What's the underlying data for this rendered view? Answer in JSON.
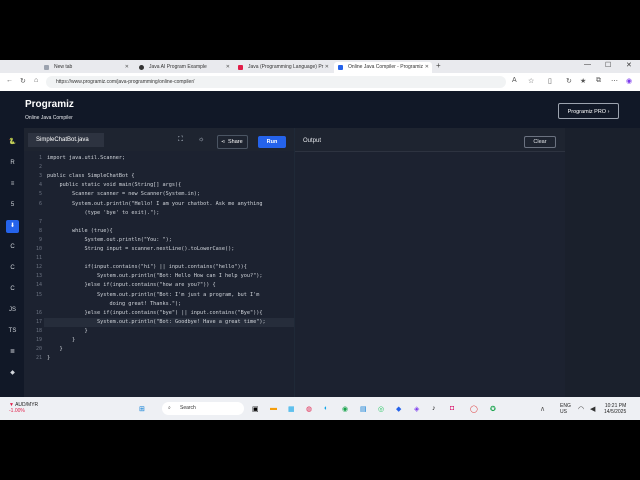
{
  "browser": {
    "tabs": [
      {
        "label": "New tab",
        "favicon_color": "#888888"
      },
      {
        "label": "Java AI Program Example",
        "favicon_color": "#333333"
      },
      {
        "label": "Java (Programming Language) Pr",
        "favicon_color": "#e11d48"
      },
      {
        "label": "Online Java Compiler - Programiz",
        "favicon_color": "#2563eb"
      }
    ],
    "new_tab_glyph": "+",
    "url": "https://www.programiz.com/java-programming/online-compiler/",
    "window_controls": [
      "—",
      "☐",
      "✕"
    ]
  },
  "site": {
    "brand": "Programiz",
    "subtitle": "Online Java Compiler",
    "pro_button": "Programiz PRO ›"
  },
  "sidebar": {
    "items": [
      {
        "icon": "python-icon",
        "glyph": "🐍"
      },
      {
        "icon": "r-icon",
        "glyph": "R"
      },
      {
        "icon": "sql-icon",
        "glyph": "≡"
      },
      {
        "icon": "html-icon",
        "glyph": "5"
      },
      {
        "icon": "java-icon",
        "glyph": "⬇"
      },
      {
        "icon": "c-icon",
        "glyph": "C"
      },
      {
        "icon": "cpp-icon",
        "glyph": "C"
      },
      {
        "icon": "csharp-icon",
        "glyph": "C"
      },
      {
        "icon": "js-icon",
        "glyph": "JS"
      },
      {
        "icon": "ts-icon",
        "glyph": "TS"
      },
      {
        "icon": "go-icon",
        "glyph": "≣"
      },
      {
        "icon": "swift-icon",
        "glyph": "◆"
      }
    ],
    "active_index": 4
  },
  "editor": {
    "filename": "SimpleChatBot.java",
    "share_label": "Share",
    "run_label": "Run",
    "lines": [
      "import java.util.Scanner;",
      "",
      "public class SimpleChatBot {",
      "    public static void main(String[] args){",
      "        Scanner scanner = new Scanner(System.in);",
      "        System.out.println(\"Hello! I am your chatbot. Ask me anything",
      "            (type 'bye' to exit).\");",
      "",
      "        while (true){",
      "            System.out.println(\"You: \");",
      "            String input = scanner.nextLine().toLowerCase();",
      "",
      "            if(input.contains(\"hi\") || input.contains(\"hello\")){",
      "                System.out.println(\"Bot: Hello How can I help you?\");",
      "            }else if(input.contains(\"how are you?\")) {",
      "                System.out.println(\"Bot: I'm just a program, but I'm",
      "                    doing great! Thanks.\");",
      "            }else if(input.contains(\"bye\") || input.contains(\"Bye\")){",
      "                System.out.println(\"Bot: Goodbye! Have a great time\");",
      "            }",
      "        }",
      "    }",
      "}"
    ],
    "line_numbers": [
      "1",
      "2",
      "3",
      "4",
      "5",
      "6",
      "",
      "7",
      "8",
      "9",
      "10",
      "11",
      "12",
      "13",
      "14",
      "15",
      "",
      "16",
      "17",
      "18",
      "19",
      "20",
      "21"
    ]
  },
  "output": {
    "label": "Output",
    "clear_label": "Clear"
  },
  "taskbar": {
    "stock_name": "AUD/MYR",
    "stock_change": "-1.00%",
    "search_placeholder": "Search",
    "lang_1": "ENG",
    "lang_2": "US",
    "time": "10:21 PM",
    "date": "14/5/2025"
  }
}
